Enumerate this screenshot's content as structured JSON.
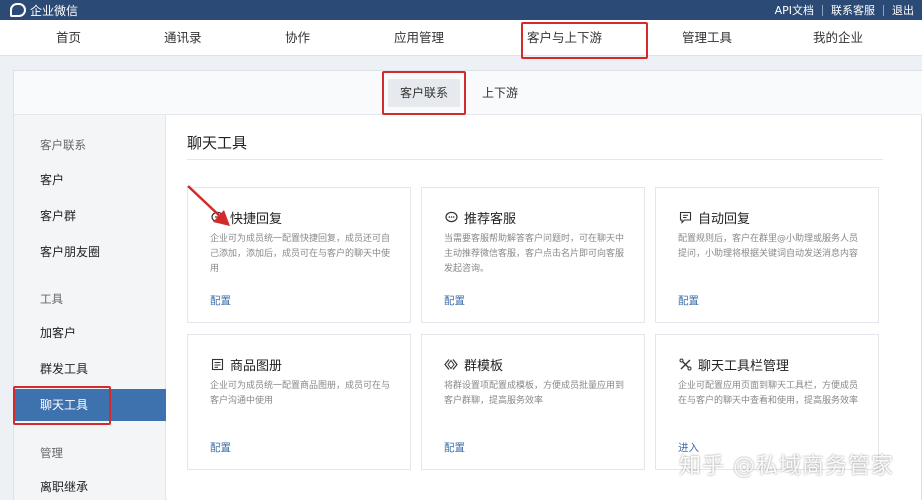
{
  "app": {
    "brand": "企业微信"
  },
  "top_links": [
    "API文档",
    "联系客服",
    "退出"
  ],
  "main_nav": [
    "首页",
    "通讯录",
    "协作",
    "应用管理",
    "客户与上下游",
    "管理工具",
    "我的企业"
  ],
  "sub_tabs": [
    "客户联系",
    "上下游"
  ],
  "sidebar": {
    "groups": [
      {
        "title": "客户联系",
        "items": [
          "客户",
          "客户群",
          "客户朋友圈"
        ]
      },
      {
        "title": "工具",
        "items": [
          "加客户",
          "群发工具",
          "聊天工具"
        ]
      },
      {
        "title": "管理",
        "items": [
          "离职继承"
        ]
      }
    ],
    "active": "聊天工具"
  },
  "content": {
    "title": "聊天工具",
    "cards": [
      {
        "icon": "quick-reply-icon",
        "title": "快捷回复",
        "desc": "企业可为成员统一配置快捷回复，成员还可自己添加，添加后，成员可在与客户的聊天中使用",
        "link": "配置"
      },
      {
        "icon": "recommend-service-icon",
        "title": "推荐客服",
        "desc": "当需要客服帮助解答客户问题时，可在聊天中主动推荐微信客服，客户点击名片即可向客服发起咨询。",
        "link": "配置"
      },
      {
        "icon": "auto-reply-icon",
        "title": "自动回复",
        "desc": "配置规则后，客户在群里@小助理或服务人员提问，小助理将根据关键词自动发送消息内容",
        "link": "配置"
      },
      {
        "icon": "product-album-icon",
        "title": "商品图册",
        "desc": "企业可为成员统一配置商品图册，成员可在与客户沟通中使用",
        "link": "配置"
      },
      {
        "icon": "group-template-icon",
        "title": "群模板",
        "desc": "将群设置项配置成模板，方便成员批量应用到客户群聊，提高服务效率",
        "link": "配置"
      },
      {
        "icon": "toolbar-manage-icon",
        "title": "聊天工具栏管理",
        "desc": "企业可配置应用页面到聊天工具栏，方便成员在与客户的聊天中查看和使用，提高服务效率",
        "link": "进入"
      }
    ]
  },
  "watermark": "知乎 @私域商务管家",
  "colors": {
    "topbar": "#2b4a75",
    "sidebar_active": "#3d72ae",
    "link": "#3d6ea8",
    "annotation": "#d52a2a"
  }
}
